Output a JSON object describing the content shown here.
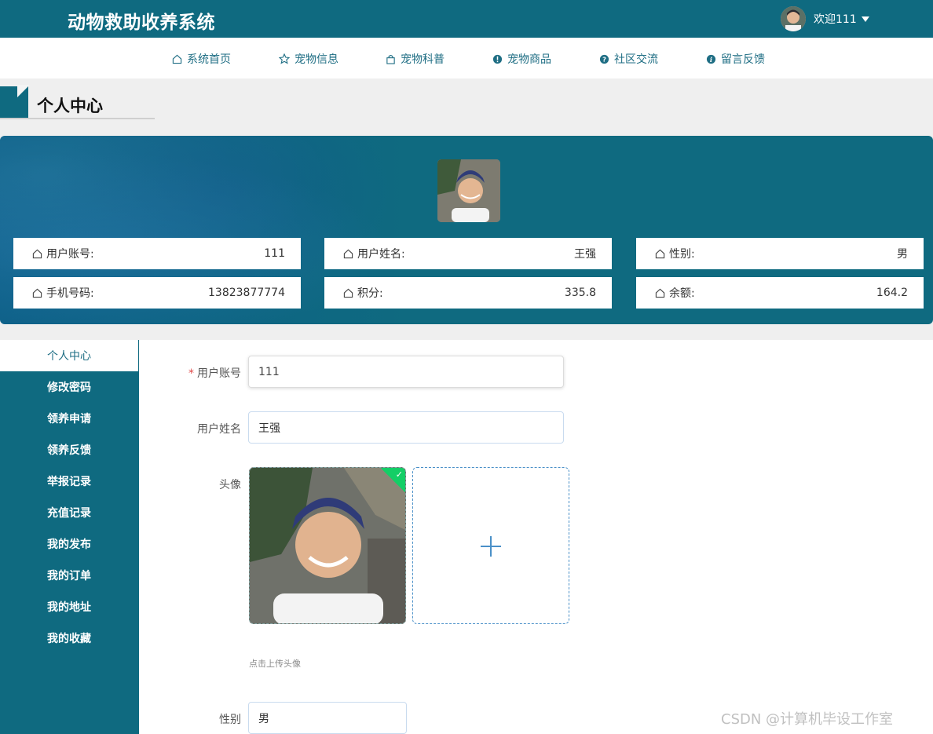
{
  "header": {
    "app_title": "动物救助收养系统",
    "welcome": "欢迎111"
  },
  "nav": {
    "items": [
      {
        "label": "系统首页",
        "icon": "home-icon"
      },
      {
        "label": "宠物信息",
        "icon": "star-icon"
      },
      {
        "label": "宠物科普",
        "icon": "bag-icon"
      },
      {
        "label": "宠物商品",
        "icon": "alert-icon"
      },
      {
        "label": "社区交流",
        "icon": "question-icon"
      },
      {
        "label": "留言反馈",
        "icon": "info-icon"
      }
    ]
  },
  "page": {
    "title": "个人中心"
  },
  "profile": {
    "fields": [
      {
        "label": "用户账号:",
        "value": "111"
      },
      {
        "label": "用户姓名:",
        "value": "王强"
      },
      {
        "label": "性别:",
        "value": "男"
      },
      {
        "label": "手机号码:",
        "value": "13823877774"
      },
      {
        "label": "积分:",
        "value": "335.8"
      },
      {
        "label": "余额:",
        "value": "164.2"
      }
    ]
  },
  "sidebar": {
    "items": [
      {
        "label": "个人中心",
        "active": true
      },
      {
        "label": "修改密码"
      },
      {
        "label": "领养申请"
      },
      {
        "label": "领养反馈"
      },
      {
        "label": "举报记录"
      },
      {
        "label": "充值记录"
      },
      {
        "label": "我的发布"
      },
      {
        "label": "我的订单"
      },
      {
        "label": "我的地址"
      },
      {
        "label": "我的收藏"
      }
    ]
  },
  "form": {
    "account_label": "用户账号",
    "account_value": "111",
    "name_label": "用户姓名",
    "name_value": "王强",
    "avatar_label": "头像",
    "upload_hint": "点击上传头像",
    "gender_label": "性别",
    "gender_value": "男"
  },
  "watermark": "CSDN @计算机毕设工作室",
  "colors": {
    "primary": "#0f6a80",
    "success": "#13ce66",
    "required": "#e04b4b"
  }
}
